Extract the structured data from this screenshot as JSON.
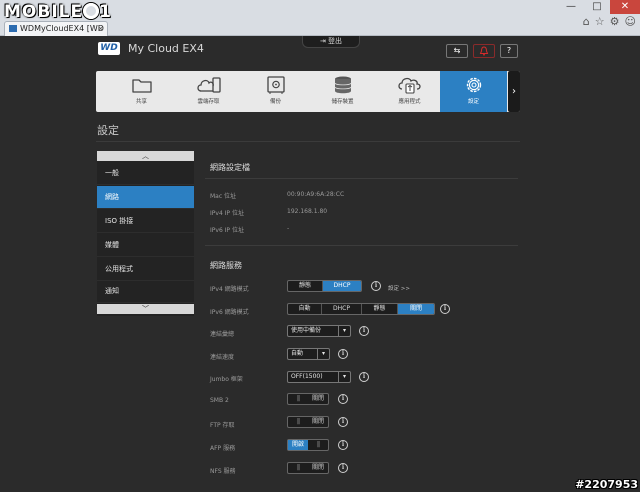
{
  "browser": {
    "watermark": "MOBILE01",
    "tab_title": "WDMyCloudEX4 [WD My...",
    "controls": {
      "minimize": "—",
      "maximize": "□",
      "close": "✕"
    },
    "nav_icons": [
      "⌂",
      "☆",
      "⚙",
      "☺"
    ]
  },
  "header": {
    "logo": "WD",
    "product": "My Cloud EX4",
    "logout_label": "登出",
    "usb_label": "⇆",
    "help_label": "?"
  },
  "nav": {
    "prev": "‹",
    "next": "›",
    "items": [
      {
        "label": "共享",
        "icon": "folder-icon"
      },
      {
        "label": "雲端存取",
        "icon": "cloud-device-icon"
      },
      {
        "label": "備份",
        "icon": "safe-icon"
      },
      {
        "label": "儲存裝置",
        "icon": "database-icon"
      },
      {
        "label": "應用程式",
        "icon": "apps-icon"
      },
      {
        "label": "設定",
        "icon": "gear-icon",
        "active": true
      }
    ]
  },
  "page_title": "設定",
  "sidebar": {
    "items": [
      {
        "label": "一般"
      },
      {
        "label": "網路",
        "active": true
      },
      {
        "label": "ISO 掛接"
      },
      {
        "label": "媒體"
      },
      {
        "label": "公用程式"
      },
      {
        "label": "通知"
      }
    ]
  },
  "profile": {
    "title": "網路設定檔",
    "rows": [
      {
        "label": "Mac 位址",
        "value": "00:90:A9:6A:28:CC"
      },
      {
        "label": "IPv4 IP 位址",
        "value": "192.168.1.80"
      },
      {
        "label": "IPv6 IP 位址",
        "value": "-"
      }
    ]
  },
  "services": {
    "title": "網路服務",
    "ipv4_mode": {
      "label": "IPv4 網路模式",
      "options": [
        "靜態",
        "DHCP"
      ],
      "selected": "DHCP",
      "link": "設定 >>"
    },
    "ipv6_mode": {
      "label": "IPv6 網路模式",
      "options": [
        "自動",
        "DHCP",
        "靜態",
        "關閉"
      ],
      "selected": "關閉"
    },
    "link_aggregation": {
      "label": "連結彙總",
      "value": "使用中備份"
    },
    "link_speed": {
      "label": "連結速度",
      "value": "自動"
    },
    "jumbo": {
      "label": "Jumbo 框架",
      "value": "OFF(1500)"
    },
    "smb2": {
      "label": "SMB 2",
      "state": "關閉"
    },
    "ftp": {
      "label": "FTP 存取",
      "state": "關閉"
    },
    "afp": {
      "label": "AFP 服務",
      "state": "開啟"
    },
    "nfs": {
      "label": "NFS 服務",
      "state": "關閉"
    }
  },
  "stamp": "#2207953",
  "colors": {
    "accent": "#2c80c3",
    "background": "#2b2b2b",
    "alert": "#d42b2b"
  }
}
